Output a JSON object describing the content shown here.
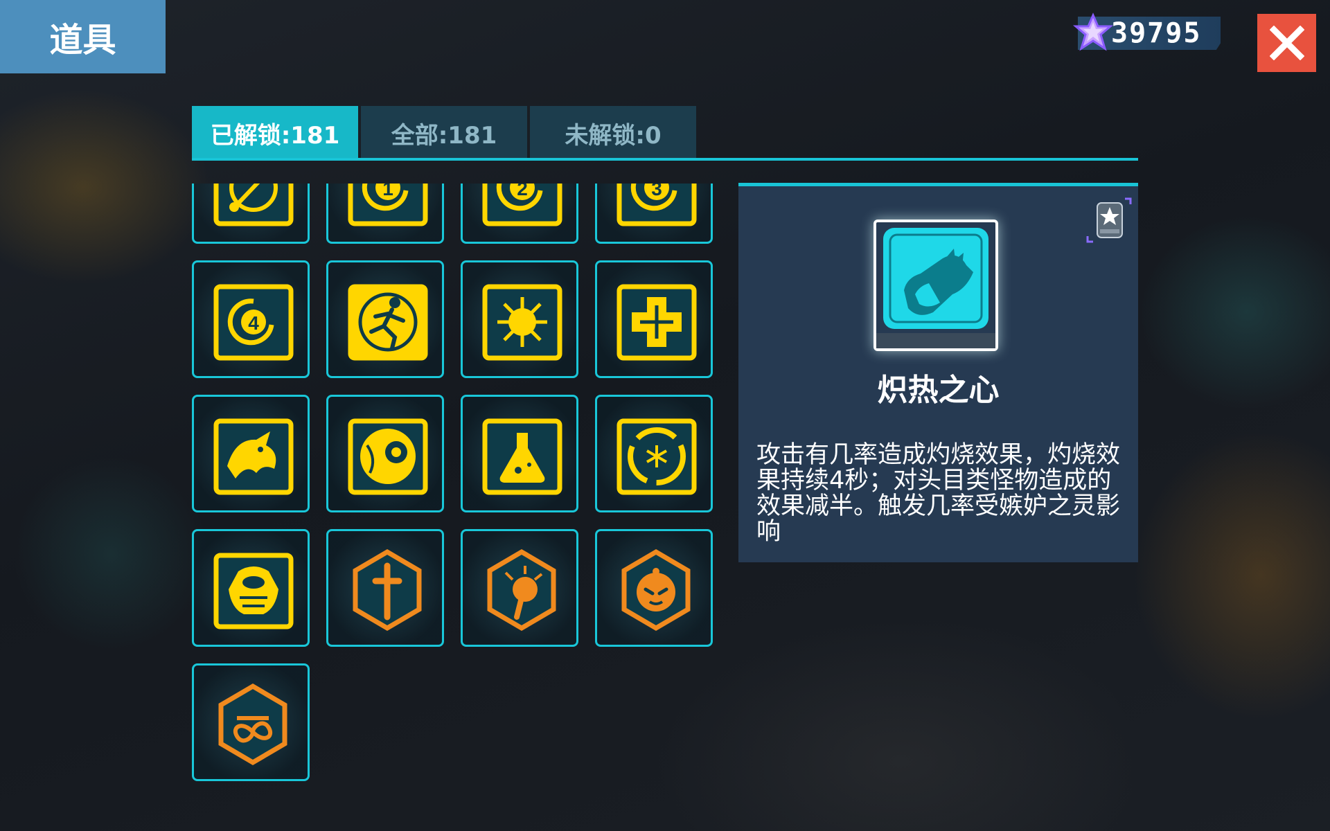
{
  "header": {
    "title": "道具"
  },
  "currency": {
    "icon": "purple-star-gem-icon",
    "value": "39795"
  },
  "close": {
    "icon": "close-icon"
  },
  "tabs": [
    {
      "label": "已解锁:181",
      "active": true
    },
    {
      "label": "全部:181",
      "active": false
    },
    {
      "label": "未解锁:0",
      "active": false
    }
  ],
  "items": [
    {
      "icon": "comet-ring-icon"
    },
    {
      "icon": "ring-number-1-icon",
      "label": "1"
    },
    {
      "icon": "ring-number-2-icon",
      "label": "2"
    },
    {
      "icon": "ring-number-3-icon",
      "label": "3"
    },
    {
      "icon": "ring-number-4-icon",
      "label": "4"
    },
    {
      "icon": "running-figure-icon"
    },
    {
      "icon": "sun-burst-icon"
    },
    {
      "icon": "cross-plus-icon"
    },
    {
      "icon": "dragon-icon"
    },
    {
      "icon": "eyeball-icon"
    },
    {
      "icon": "potion-flask-icon"
    },
    {
      "icon": "snowflake-swirl-icon"
    },
    {
      "icon": "armor-torso-icon"
    },
    {
      "icon": "sword-hexagon-icon"
    },
    {
      "icon": "fist-hexagon-icon"
    },
    {
      "icon": "demon-face-hexagon-icon"
    },
    {
      "icon": "infinity-hexagon-icon"
    }
  ],
  "detail": {
    "name": "炽热之心",
    "icon": "burning-heart-icon",
    "badge_icon": "star-badge-icon",
    "description": "攻击有几率造成灼烧效果，灼烧效果持续4秒；对头目类怪物造成的效果减半。触发几率受嫉妒之灵影响"
  },
  "colors": {
    "accent": "#19c4d6",
    "item_yellow": "#ffd600",
    "item_orange": "#f08a1e",
    "close_red": "#e8523e",
    "title_blue": "#4d8fbd",
    "panel_bg": "#263a52"
  }
}
